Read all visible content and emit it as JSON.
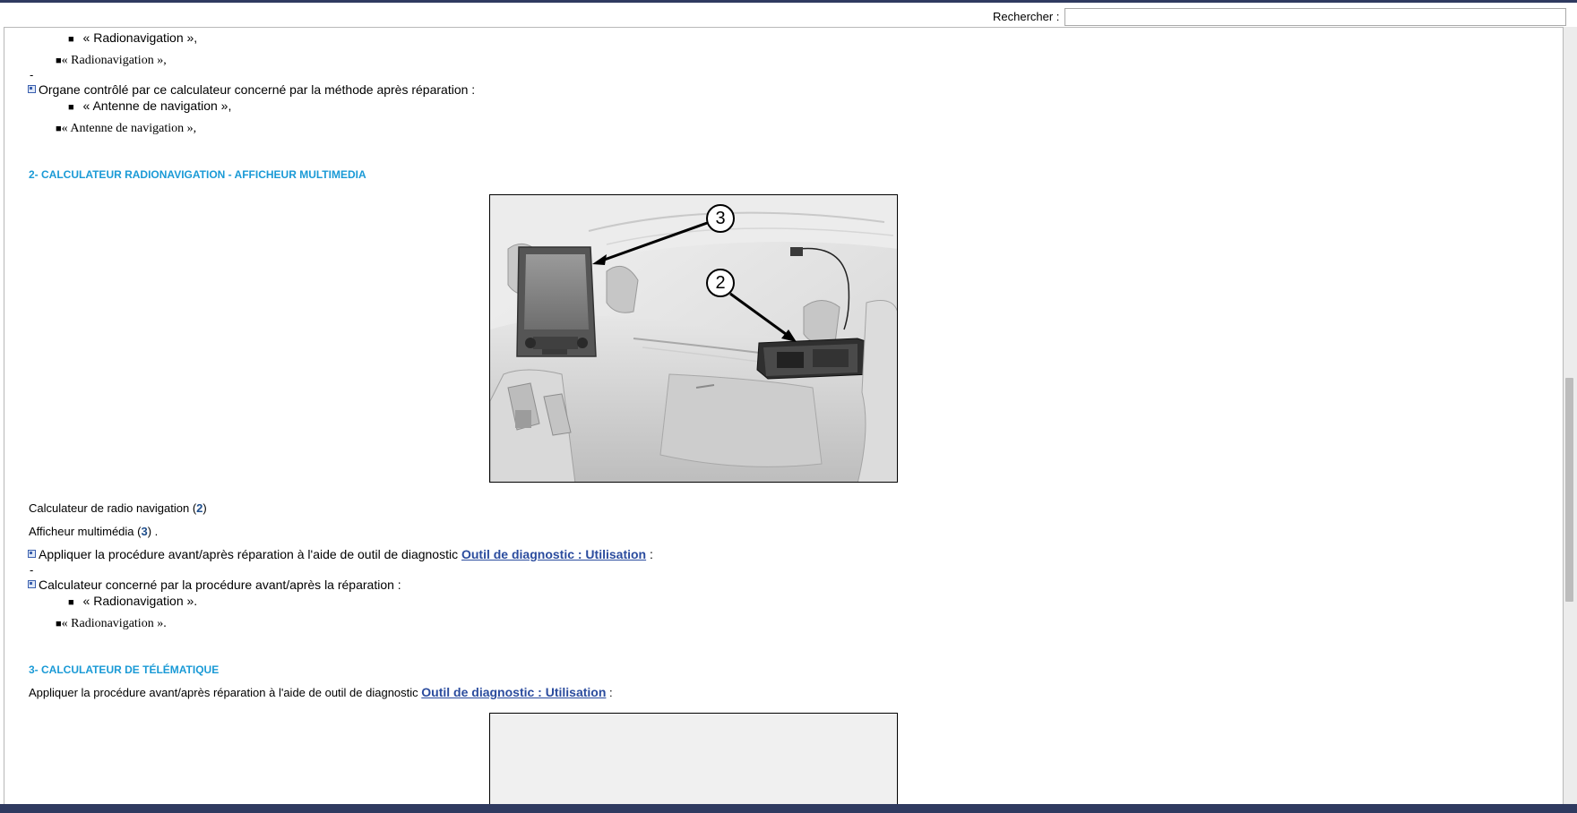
{
  "search": {
    "label": "Rechercher :",
    "value": "",
    "placeholder": ""
  },
  "section1": {
    "bullet_top": "« Radionavigation »,",
    "serif_top": "« Radionavigation »,",
    "dash_1": "-",
    "organe_text": "Organe contrôlé par ce calculateur concerné par la méthode après réparation :",
    "bullet_antenne": "« Antenne de navigation »,",
    "serif_antenne": "« Antenne de navigation »,"
  },
  "section2": {
    "heading": "2- CALCULATEUR RADIONAVIGATION - AFFICHEUR MULTIMEDIA",
    "callout_3": "3",
    "callout_2": "2",
    "caption_radio_text": "Calculateur de radio navigation (",
    "caption_radio_ref": "2",
    "caption_radio_end": ")",
    "caption_display_text": "Afficheur multimédia (",
    "caption_display_ref": "3",
    "caption_display_end": ") .",
    "apply_text": "Appliquer la procédure avant/après réparation à l'aide de outil de diagnostic",
    "apply_link": "Outil de diagnostic : Utilisation",
    "apply_end": ":",
    "dash_2": "-",
    "calc_text": "Calculateur concerné par la procédure avant/après la réparation :",
    "bullet_radio": "« Radionavigation ».",
    "serif_radio": "« Radionavigation »."
  },
  "section3": {
    "heading": "3- CALCULATEUR DE TÉLÉMATIQUE",
    "apply_text": "Appliquer la procédure avant/après réparation à l'aide de outil de diagnostic",
    "apply_link": "Outil de diagnostic : Utilisation",
    "apply_end": ":"
  },
  "colors": {
    "frame": "#2f3a60",
    "heading": "#1a9ad6",
    "link": "#2b4c9e"
  }
}
